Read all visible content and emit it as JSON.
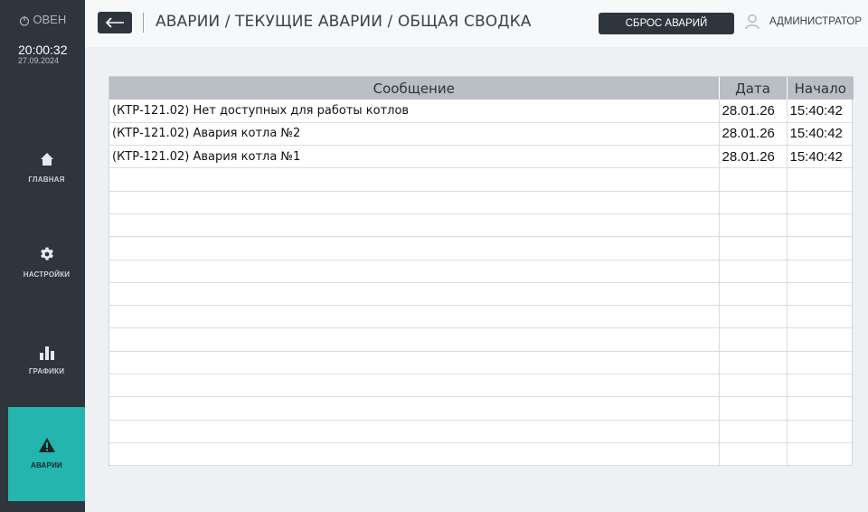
{
  "sidebar": {
    "brand": "ОВЕН",
    "time": "20:00:32",
    "date": "27.09.2024",
    "items": [
      {
        "label": "ГЛАВНАЯ",
        "icon": "home-icon"
      },
      {
        "label": "НАСТРОЙКИ",
        "icon": "gear-icon"
      },
      {
        "label": "ГРАФИКИ",
        "icon": "chart-icon"
      },
      {
        "label": "АВАРИИ",
        "icon": "warning-icon",
        "active": true
      }
    ]
  },
  "header": {
    "back_icon": "arrow-left-icon",
    "breadcrumb": "АВАРИИ / ТЕКУЩИЕ АВАРИИ / ОБЩАЯ СВОДКА",
    "reset_label": "СБРОС АВАРИЙ",
    "user_label": "АДМИНИСТРАТОР"
  },
  "table": {
    "columns": [
      "Сообщение",
      "Дата",
      "Начало"
    ],
    "rows": [
      [
        "(КТР-121.02) Нет доступных для работы котлов",
        "28.01.26",
        "15:40:42"
      ],
      [
        "(КТР-121.02) Авария котла №2",
        "28.01.26",
        "15:40:42"
      ],
      [
        "(КТР-121.02) Авария котла №1",
        "28.01.26",
        "15:40:42"
      ],
      [
        "",
        "",
        ""
      ],
      [
        "",
        "",
        ""
      ],
      [
        "",
        "",
        ""
      ],
      [
        "",
        "",
        ""
      ],
      [
        "",
        "",
        ""
      ],
      [
        "",
        "",
        ""
      ],
      [
        "",
        "",
        ""
      ],
      [
        "",
        "",
        ""
      ],
      [
        "",
        "",
        ""
      ],
      [
        "",
        "",
        ""
      ],
      [
        "",
        "",
        ""
      ],
      [
        "",
        "",
        ""
      ],
      [
        "",
        "",
        ""
      ]
    ]
  },
  "colors": {
    "sidebar_bg": "#2e353d",
    "accent": "#24b5ae",
    "header_bg": "#f7f8f9",
    "table_header_bg": "#b9bec4"
  }
}
